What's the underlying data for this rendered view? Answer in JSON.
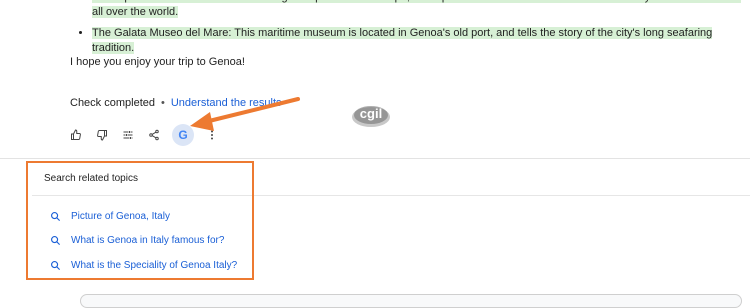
{
  "bullets": [
    "The Aquarium of Genoa: One of the largest aquariums in Europe, the Aquarium of Genoa is home to a wide variety of marine life from all over the world.",
    "The Galata Museo del Mare: This maritime museum is located in Genoa's old port, and tells the story of the city's long seafaring tradition."
  ],
  "closing_text": "I hope you enjoy your trip to Genoa!",
  "check": {
    "status": "Check completed",
    "separator": "•",
    "link": "Understand the results"
  },
  "toolbar_icons": [
    "thumbs-up-icon",
    "thumbs-down-icon",
    "tune-icon",
    "share-icon",
    "google-icon",
    "more-vert-icon"
  ],
  "google_letter": "G",
  "watermark_text": "cgil",
  "related": {
    "title": "Search related topics",
    "topics": [
      "Picture of Genoa, Italy",
      "What is Genoa in Italy famous for?",
      "What is the Speciality of Genoa Italy?"
    ]
  },
  "colors": {
    "highlight": "#d7f0d5",
    "link": "#1a5fd6",
    "annotation": "#ed7a31",
    "google_button_bg": "#dbe5f6"
  }
}
